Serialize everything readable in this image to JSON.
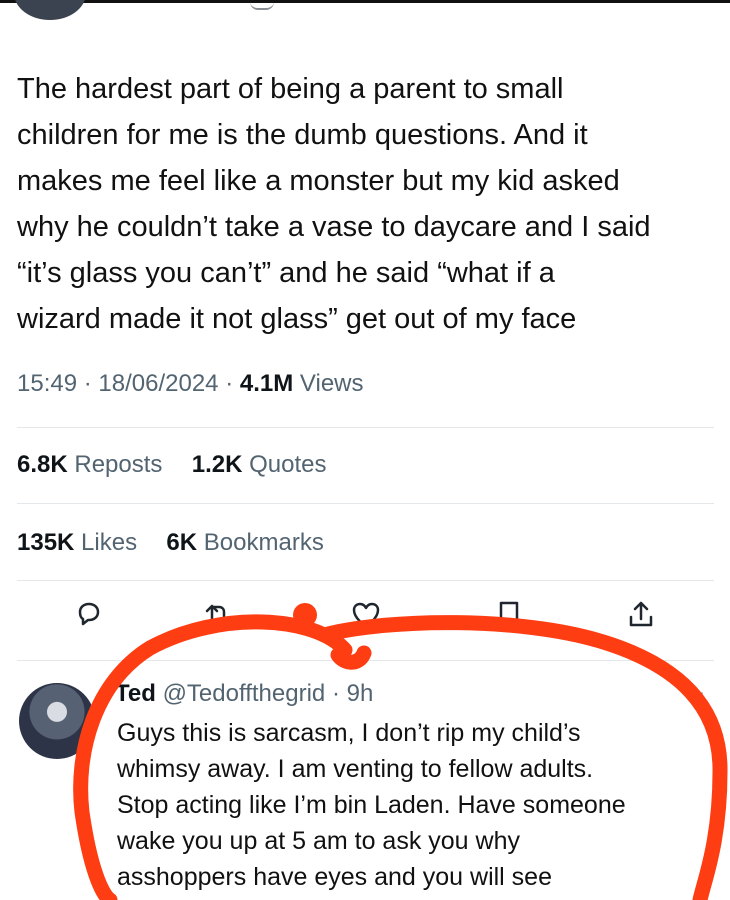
{
  "tweet": {
    "lines": [
      "The hardest part of being a parent to small",
      "children for me is the dumb questions. And it",
      "makes me feel like a monster but my kid asked",
      "why he couldn’t take a vase to daycare and I said",
      "“it’s glass you can’t” and he said “what if a",
      "wizard made it not glass” get out of my face"
    ],
    "time": "15:49",
    "date": "18/06/2024",
    "views_count": "4.1M",
    "views_label": "Views"
  },
  "stats": {
    "reposts_count": "6.8K",
    "reposts_label": "Reposts",
    "quotes_count": "1.2K",
    "quotes_label": "Quotes",
    "likes_count": "135K",
    "likes_label": "Likes",
    "bookmarks_count": "6K",
    "bookmarks_label": "Bookmarks"
  },
  "actions": {
    "icons": [
      "reply-icon",
      "repost-icon",
      "like-icon",
      "bookmark-icon",
      "share-icon"
    ]
  },
  "reply": {
    "name": "Ted",
    "handle": "@Tedoffthegrid",
    "time": "9h",
    "more": "···",
    "lines": [
      "Guys this is sarcasm, I don’t rip my child’s",
      "whimsy away. I am venting to fellow adults.",
      "Stop acting like I’m bin Laden. Have someone",
      "wake you up at 5 am to ask you why",
      "asshoppers have eyes and you will see"
    ]
  },
  "colors": {
    "text": "#0f1419",
    "secondary": "#536471",
    "divider": "#e4e8eb",
    "annotation": "#ff3d12"
  }
}
